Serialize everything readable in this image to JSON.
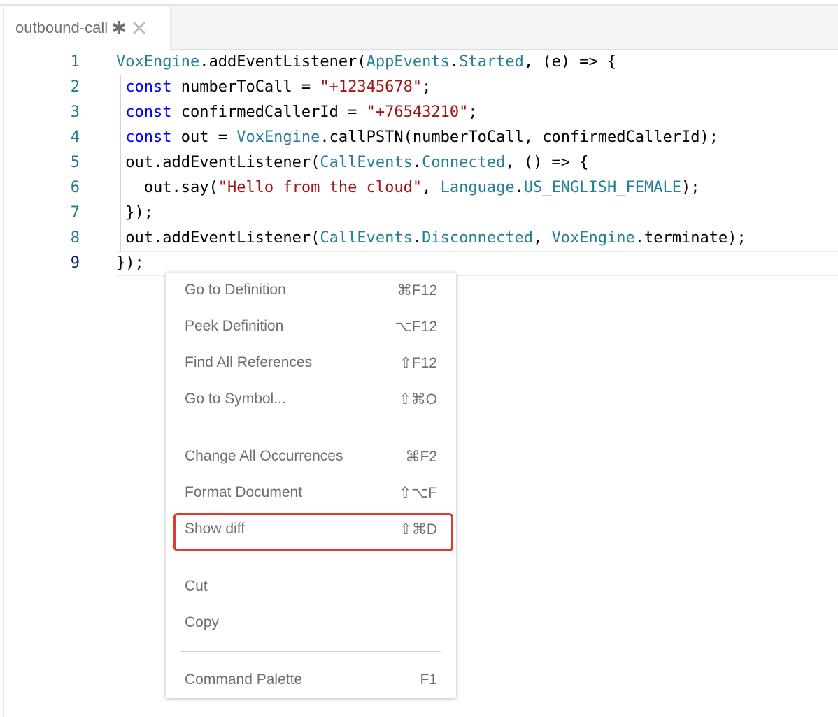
{
  "tab": {
    "title": "outbound-call",
    "dirty_marker": "✱"
  },
  "icons": {
    "close": "close-icon"
  },
  "editor": {
    "active_line": 9,
    "lines": [
      {
        "number": "1",
        "tokens": [
          {
            "t": "VoxEngine",
            "c": "type"
          },
          {
            "t": ".addEventListener(",
            "c": "plain"
          },
          {
            "t": "AppEvents",
            "c": "type"
          },
          {
            "t": ".",
            "c": "plain"
          },
          {
            "t": "Started",
            "c": "type"
          },
          {
            "t": ", (e) => {",
            "c": "plain"
          }
        ]
      },
      {
        "number": "2",
        "tokens": [
          {
            "t": " ",
            "c": "plain"
          },
          {
            "t": "const",
            "c": "kw"
          },
          {
            "t": " numberToCall = ",
            "c": "plain"
          },
          {
            "t": "\"+12345678\"",
            "c": "str"
          },
          {
            "t": ";",
            "c": "plain"
          }
        ]
      },
      {
        "number": "3",
        "tokens": [
          {
            "t": " ",
            "c": "plain"
          },
          {
            "t": "const",
            "c": "kw"
          },
          {
            "t": " confirmedCallerId = ",
            "c": "plain"
          },
          {
            "t": "\"+76543210\"",
            "c": "str"
          },
          {
            "t": ";",
            "c": "plain"
          }
        ]
      },
      {
        "number": "4",
        "tokens": [
          {
            "t": " ",
            "c": "plain"
          },
          {
            "t": "const",
            "c": "kw"
          },
          {
            "t": " out = ",
            "c": "plain"
          },
          {
            "t": "VoxEngine",
            "c": "type"
          },
          {
            "t": ".callPSTN(numberToCall, confirmedCallerId);",
            "c": "plain"
          }
        ]
      },
      {
        "number": "5",
        "tokens": [
          {
            "t": " out.addEventListener(",
            "c": "plain"
          },
          {
            "t": "CallEvents",
            "c": "type"
          },
          {
            "t": ".",
            "c": "plain"
          },
          {
            "t": "Connected",
            "c": "type"
          },
          {
            "t": ", () => {",
            "c": "plain"
          }
        ]
      },
      {
        "number": "6",
        "tokens": [
          {
            "t": "   out.say(",
            "c": "plain"
          },
          {
            "t": "\"Hello from the cloud\"",
            "c": "str"
          },
          {
            "t": ", ",
            "c": "plain"
          },
          {
            "t": "Language",
            "c": "type"
          },
          {
            "t": ".",
            "c": "plain"
          },
          {
            "t": "US_ENGLISH_FEMALE",
            "c": "type"
          },
          {
            "t": ");",
            "c": "plain"
          }
        ]
      },
      {
        "number": "7",
        "tokens": [
          {
            "t": " });",
            "c": "plain"
          }
        ]
      },
      {
        "number": "8",
        "tokens": [
          {
            "t": " out.addEventListener(",
            "c": "plain"
          },
          {
            "t": "CallEvents",
            "c": "type"
          },
          {
            "t": ".",
            "c": "plain"
          },
          {
            "t": "Disconnected",
            "c": "type"
          },
          {
            "t": ", ",
            "c": "plain"
          },
          {
            "t": "VoxEngine",
            "c": "type"
          },
          {
            "t": ".terminate);",
            "c": "plain"
          }
        ]
      },
      {
        "number": "9",
        "tokens": [
          {
            "t": "});",
            "c": "plain"
          }
        ]
      }
    ]
  },
  "context_menu": {
    "items": [
      {
        "label": "Go to Definition",
        "shortcut": "⌘F12"
      },
      {
        "label": "Peek Definition",
        "shortcut": "⌥F12"
      },
      {
        "label": "Find All References",
        "shortcut": "⇧F12"
      },
      {
        "label": "Go to Symbol...",
        "shortcut": "⇧⌘O"
      },
      {
        "label": "Change All Occurrences",
        "shortcut": "⌘F2"
      },
      {
        "label": "Format Document",
        "shortcut": "⇧⌥F"
      },
      {
        "label": "Show diff",
        "shortcut": "⇧⌘D",
        "highlighted": true
      },
      {
        "label": "Cut",
        "shortcut": ""
      },
      {
        "label": "Copy",
        "shortcut": ""
      },
      {
        "label": "Command Palette",
        "shortcut": "F1"
      }
    ]
  },
  "colors": {
    "keyword": "#0000ff",
    "string": "#a31515",
    "type": "#267f99",
    "line_number": "#237893",
    "active_line_number": "#0b216f",
    "highlight_border": "#e0392f"
  }
}
